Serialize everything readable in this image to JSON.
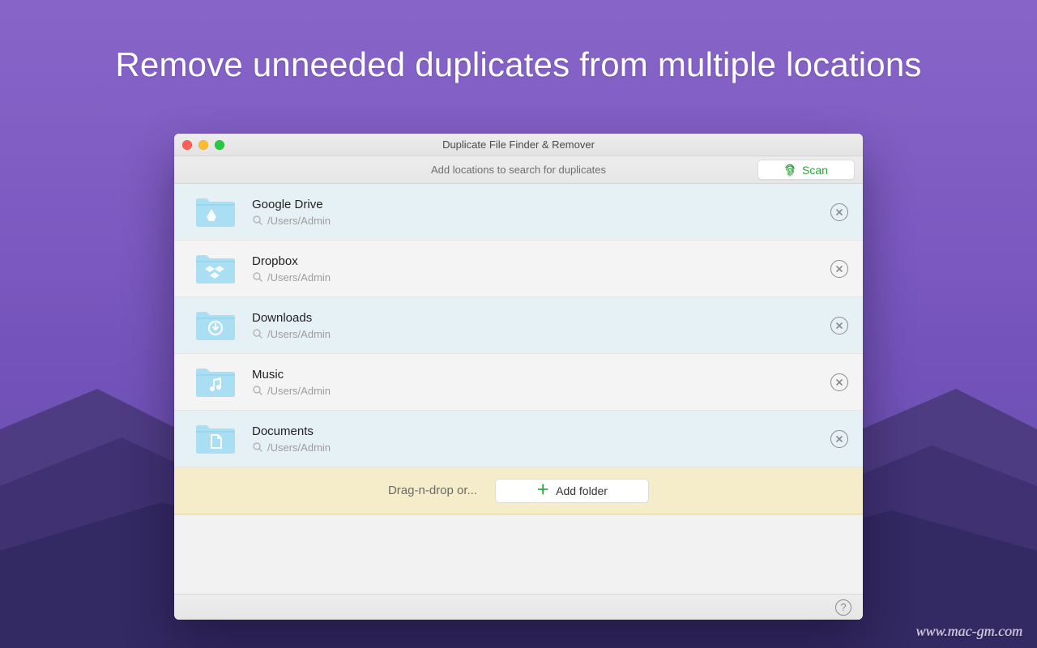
{
  "headline": "Remove unneeded duplicates from multiple locations",
  "window": {
    "title": "Duplicate File Finder & Remover"
  },
  "toolbar": {
    "hint": "Add locations to search for duplicates",
    "scan_label": "Scan"
  },
  "dropzone": {
    "hint": "Drag-n-drop or...",
    "add_label": "Add folder"
  },
  "watermark": "www.mac-gm.com",
  "locations": [
    {
      "name": "Google Drive",
      "path": "/Users/Admin",
      "icon": "google-drive"
    },
    {
      "name": "Dropbox",
      "path": "/Users/Admin",
      "icon": "dropbox"
    },
    {
      "name": "Downloads",
      "path": "/Users/Admin",
      "icon": "downloads"
    },
    {
      "name": "Music",
      "path": "/Users/Admin",
      "icon": "music"
    },
    {
      "name": "Documents",
      "path": "/Users/Admin",
      "icon": "documents"
    }
  ]
}
